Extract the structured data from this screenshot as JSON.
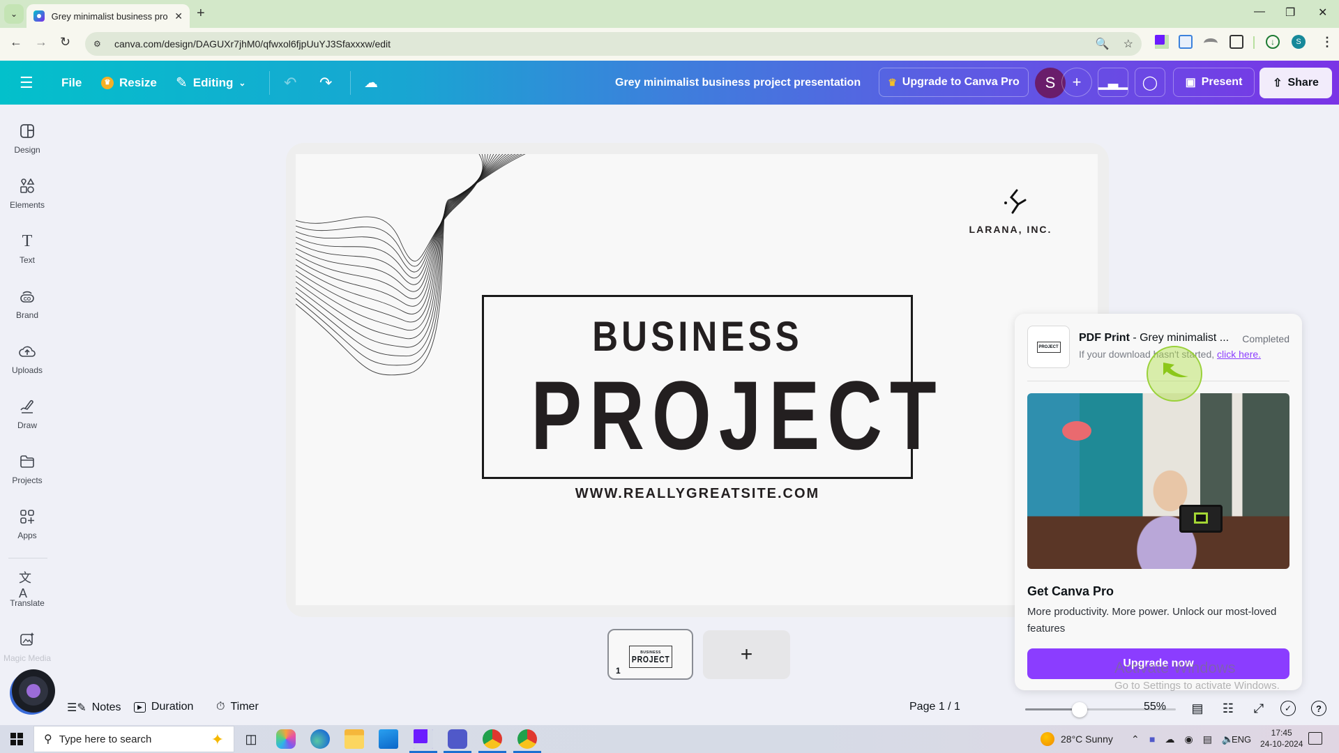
{
  "browser": {
    "tab_title": "Grey minimalist business project presentation",
    "url": "canva.com/design/DAGUXr7jhM0/qfwxol6fjpUuYJ3Sfaxxxw/edit",
    "profile_initial": "S",
    "icons": [
      "tab-list-icon",
      "canva-favicon",
      "close-tab-icon",
      "new-tab-icon",
      "minimize-icon",
      "restore-icon",
      "close-window-icon",
      "back-icon",
      "forward-icon",
      "reload-icon",
      "site-info-icon",
      "zoom-icon",
      "bookmark-star-icon",
      "extension-icon",
      "download-icon",
      "menu-kebab-icon"
    ]
  },
  "toolbar": {
    "menu_icon": "hamburger-icon",
    "file": "File",
    "resize": "Resize",
    "editing": "Editing",
    "doc_title": "Grey minimalist business project presentation",
    "upgrade": "Upgrade to Canva Pro",
    "avatar_initial": "S",
    "present": "Present",
    "share": "Share",
    "accent_gradient": [
      "#03c0cb",
      "#3d7fdc",
      "#7a34e6"
    ]
  },
  "sidebar": {
    "items": [
      {
        "label": "Design",
        "icon": "design-icon"
      },
      {
        "label": "Elements",
        "icon": "elements-icon"
      },
      {
        "label": "Text",
        "icon": "text-icon"
      },
      {
        "label": "Brand",
        "icon": "brand-icon"
      },
      {
        "label": "Uploads",
        "icon": "uploads-icon"
      },
      {
        "label": "Draw",
        "icon": "draw-icon"
      },
      {
        "label": "Projects",
        "icon": "projects-icon"
      },
      {
        "label": "Apps",
        "icon": "apps-icon"
      },
      {
        "label": "Translate",
        "icon": "translate-icon"
      },
      {
        "label": "Magic Media",
        "icon": "magic-media-icon"
      }
    ]
  },
  "design": {
    "logo_text": "LARANA, INC.",
    "title_small": "BUSINESS",
    "title_large": "PROJECT",
    "website": "WWW.REALLYGREATSITE.COM"
  },
  "pages": {
    "thumb_number": "1",
    "thumb_small": "BUSINESS",
    "thumb_large": "PROJECT",
    "add_page": "+"
  },
  "bottombar": {
    "notes": "Notes",
    "duration": "Duration",
    "timer": "Timer",
    "page_indicator": "Page 1 / 1",
    "zoom_percent": "55%",
    "zoom_value": 55,
    "zoom_slider_fraction": 0.36
  },
  "popup": {
    "pdf_type": "PDF Print",
    "pdf_name": " - Grey minimalist ...",
    "status": "Completed",
    "sub_text": "If your download hasn't started, ",
    "link_text": "click here.",
    "promo_heading": "Get Canva Pro",
    "promo_text": "More productivity. More power. Unlock our most-loved features",
    "upgrade_button": "Upgrade now",
    "button_color": "#8b3dff"
  },
  "watermark": {
    "line1": "Activate Windows",
    "line2": "Go to Settings to activate Windows."
  },
  "taskbar": {
    "search_placeholder": "Type here to search",
    "weather": "28°C  Sunny",
    "language": "ENG",
    "time": "17:45",
    "date": "24-10-2024",
    "apps": [
      "task-view",
      "copilot",
      "edge",
      "file-explorer",
      "mail",
      "canva",
      "teams",
      "chrome-profile-a",
      "chrome-profile-s"
    ]
  }
}
